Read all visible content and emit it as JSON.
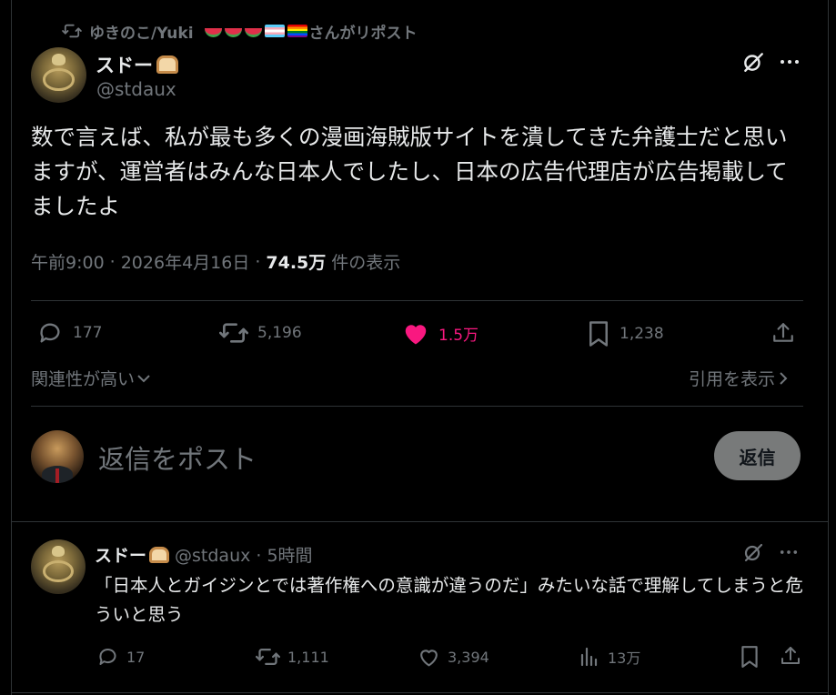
{
  "repost": {
    "text": "ゆきのこ/Yuki ",
    "suffix": "さんがリポスト"
  },
  "post": {
    "author_name": "スドー",
    "handle": "@stdaux",
    "text": "数で言えば、私が最も多くの漫画海賊版サイトを潰してきた弁護士だと思いますが、運営者はみんな日本人でしたし、日本の広告代理店が広告掲載してましたよ",
    "time": "午前9:00",
    "sep": "·",
    "date": "2026年4月16日",
    "views": "74.5万",
    "views_label": "件の表示",
    "replies": "177",
    "reposts": "5,196",
    "likes": "1.5万",
    "bookmarks": "1,238",
    "related_sort": "関連性が高い",
    "view_quotes": "引用を表示"
  },
  "composer": {
    "placeholder": "返信をポスト",
    "button": "返信"
  },
  "reply": {
    "author_name": "スドー",
    "handle_time": "@stdaux · 5時間",
    "text": "「日本人とガイジンとでは著作権への意識が違うのだ」みたいな話で理解してしまうと危ういと思う",
    "replies": "17",
    "reposts": "1,111",
    "likes": "3,394",
    "views": "13万"
  },
  "colors": {
    "accent_like": "#f91880",
    "muted": "#71767b",
    "text": "#e7e9ea",
    "background": "#000000",
    "button_bg": "#787a7a"
  }
}
